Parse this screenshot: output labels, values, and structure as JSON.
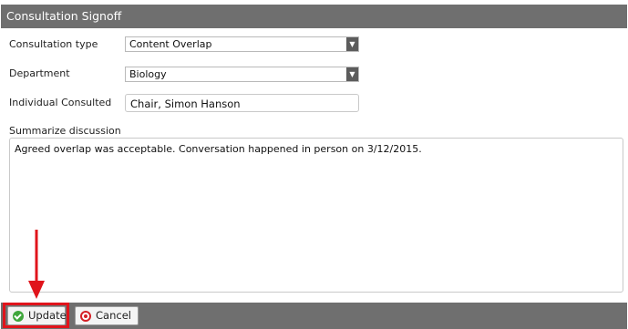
{
  "window": {
    "title": "Consultation Signoff"
  },
  "form": {
    "consultation_type": {
      "label": "Consultation type",
      "value": "Content Overlap"
    },
    "department": {
      "label": "Department",
      "value": "Biology"
    },
    "individual": {
      "label": "Individual Consulted",
      "value": "Chair, Simon Hanson"
    },
    "summary": {
      "label": "Summarize discussion",
      "value": "Agreed overlap was acceptable. Conversation happened in person on 3/12/2015."
    }
  },
  "actions": {
    "update_label": "Update",
    "cancel_label": "Cancel"
  },
  "colors": {
    "title_bar": "#6f6f6f",
    "annotation": "#e0141b",
    "update_icon": "#3fa63b",
    "cancel_icon": "#d42026"
  },
  "icons": {
    "select_arrow": "dropdown-arrow-icon",
    "update": "check-circle-icon",
    "cancel": "cancel-circle-icon"
  }
}
